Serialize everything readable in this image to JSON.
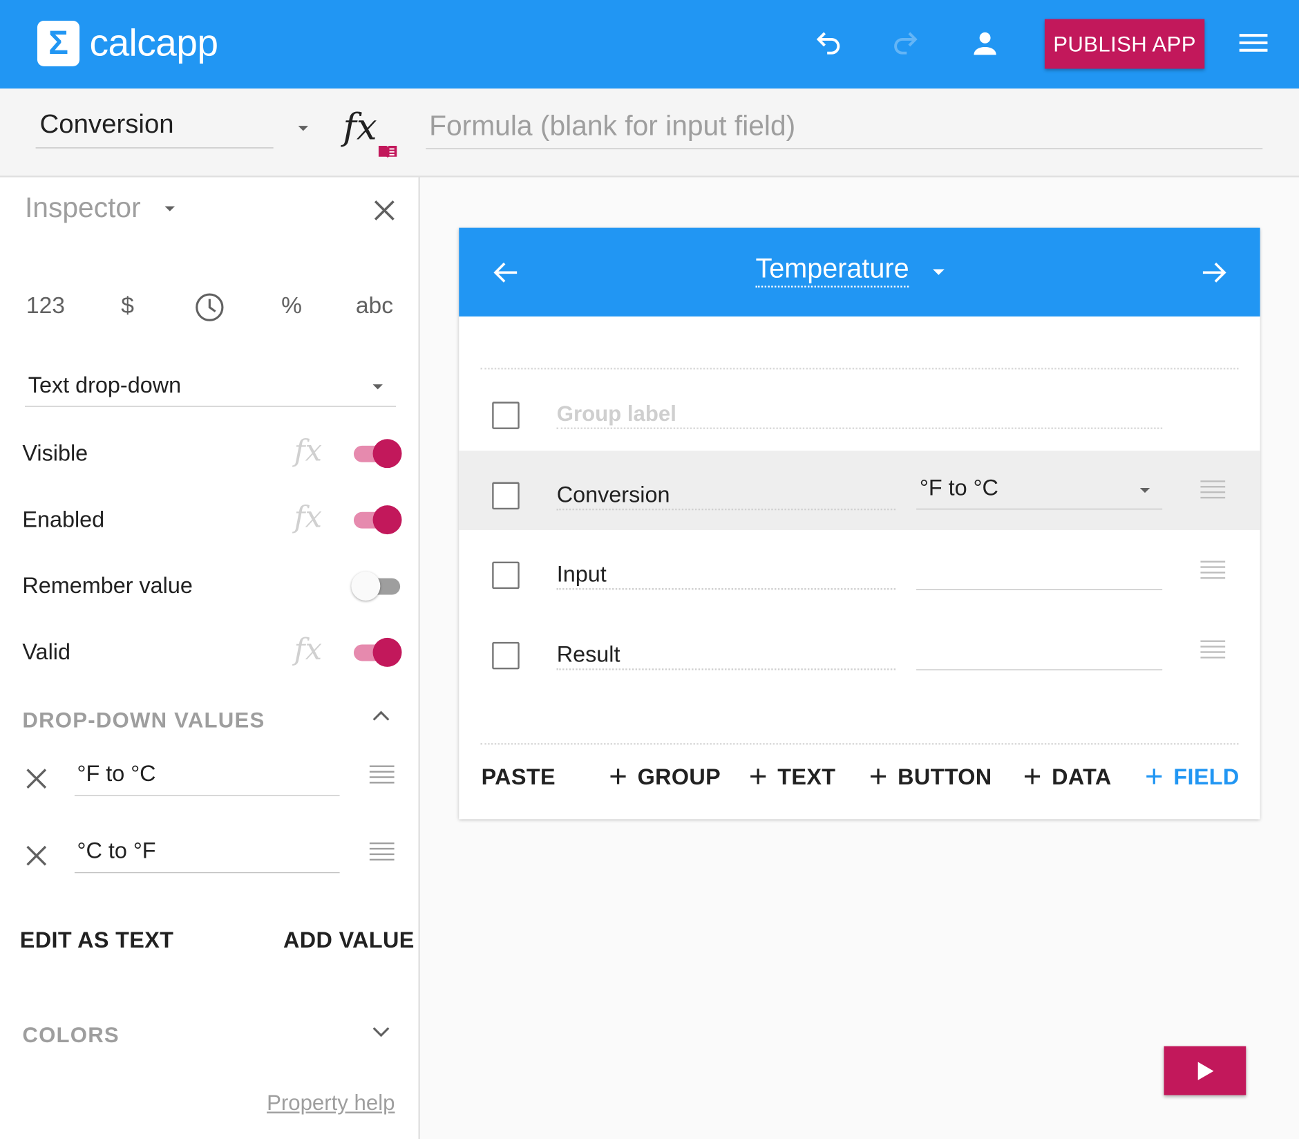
{
  "app": {
    "name": "calcapp",
    "logo_glyph": "Σ",
    "accent": "#2196f3",
    "brand": "#c2185b"
  },
  "topbar": {
    "publish_label": "PUBLISH APP"
  },
  "formula_bar": {
    "field_name": "Conversion",
    "fx_glyph": "fx",
    "formula_placeholder": "Formula (blank for input field)",
    "formula_value": ""
  },
  "inspector": {
    "title": "Inspector",
    "types": [
      "123",
      "$",
      "clock",
      "%",
      "abc"
    ],
    "field_kind": "Text drop-down",
    "properties": [
      {
        "label": "Visible",
        "on": true,
        "fx": true
      },
      {
        "label": "Enabled",
        "on": true,
        "fx": true
      },
      {
        "label": "Remember value",
        "on": false,
        "fx": false
      },
      {
        "label": "Valid",
        "on": true,
        "fx": true
      }
    ],
    "dropdown_section": "DROP-DOWN VALUES",
    "dropdown_values": [
      "°F to °C",
      "°C to °F"
    ],
    "edit_as_text": "EDIT AS TEXT",
    "add_value": "ADD VALUE",
    "colors_section": "COLORS",
    "property_help": "Property help"
  },
  "canvas": {
    "screen_title": "Temperature",
    "group_label_placeholder": "Group label",
    "rows": [
      {
        "label": "Conversion",
        "value": "°F to °C",
        "selected": true,
        "dropdown": true
      },
      {
        "label": "Input",
        "value": "",
        "selected": false,
        "dropdown": false
      },
      {
        "label": "Result",
        "value": "",
        "selected": false,
        "dropdown": false
      }
    ],
    "paste": "PASTE",
    "add_buttons": [
      "GROUP",
      "TEXT",
      "BUTTON",
      "DATA",
      "FIELD"
    ],
    "plus_glyph": "+"
  }
}
